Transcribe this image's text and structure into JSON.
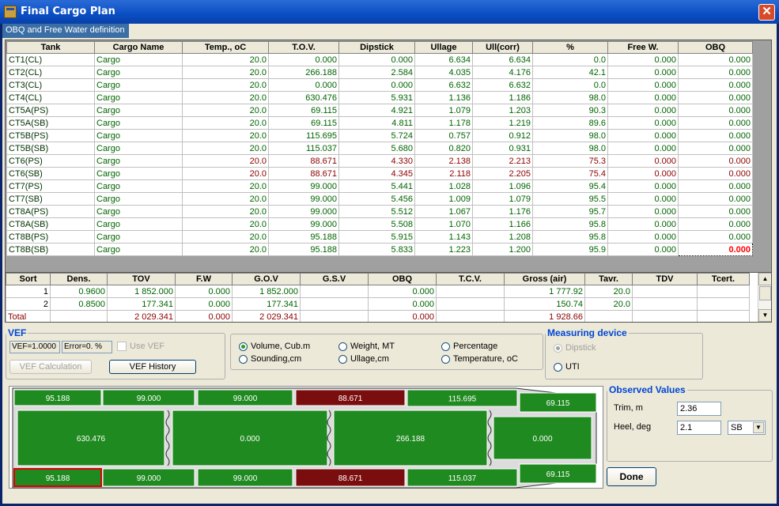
{
  "window": {
    "title": "Final Cargo Plan",
    "close_glyph": "✕"
  },
  "tab": {
    "label": "OBQ and Free Water definition"
  },
  "tank_table": {
    "headers": [
      "Tank",
      "Cargo Name",
      "Temp., oC",
      "T.O.V.",
      "Dipstick",
      "Ullage",
      "Ull(corr)",
      "%",
      "Free W.",
      "OBQ"
    ],
    "rows": [
      {
        "tank": "CT1(CL)",
        "cargo": "Cargo",
        "temp": "20.0",
        "tov": "0.000",
        "dipstick": "0.000",
        "ullage": "6.634",
        "ullcorr": "6.634",
        "pct": "0.0",
        "freew": "0.000",
        "obq": "0.000",
        "status": "green"
      },
      {
        "tank": "CT2(CL)",
        "cargo": "Cargo",
        "temp": "20.0",
        "tov": "266.188",
        "dipstick": "2.584",
        "ullage": "4.035",
        "ullcorr": "4.176",
        "pct": "42.1",
        "freew": "0.000",
        "obq": "0.000",
        "status": "green"
      },
      {
        "tank": "CT3(CL)",
        "cargo": "Cargo",
        "temp": "20.0",
        "tov": "0.000",
        "dipstick": "0.000",
        "ullage": "6.632",
        "ullcorr": "6.632",
        "pct": "0.0",
        "freew": "0.000",
        "obq": "0.000",
        "status": "green"
      },
      {
        "tank": "CT4(CL)",
        "cargo": "Cargo",
        "temp": "20.0",
        "tov": "630.476",
        "dipstick": "5.931",
        "ullage": "1.136",
        "ullcorr": "1.186",
        "pct": "98.0",
        "freew": "0.000",
        "obq": "0.000",
        "status": "green"
      },
      {
        "tank": "CT5A(PS)",
        "cargo": "Cargo",
        "temp": "20.0",
        "tov": "69.115",
        "dipstick": "4.921",
        "ullage": "1.079",
        "ullcorr": "1.203",
        "pct": "90.3",
        "freew": "0.000",
        "obq": "0.000",
        "status": "green"
      },
      {
        "tank": "CT5A(SB)",
        "cargo": "Cargo",
        "temp": "20.0",
        "tov": "69.115",
        "dipstick": "4.811",
        "ullage": "1.178",
        "ullcorr": "1.219",
        "pct": "89.6",
        "freew": "0.000",
        "obq": "0.000",
        "status": "green"
      },
      {
        "tank": "CT5B(PS)",
        "cargo": "Cargo",
        "temp": "20.0",
        "tov": "115.695",
        "dipstick": "5.724",
        "ullage": "0.757",
        "ullcorr": "0.912",
        "pct": "98.0",
        "freew": "0.000",
        "obq": "0.000",
        "status": "green"
      },
      {
        "tank": "CT5B(SB)",
        "cargo": "Cargo",
        "temp": "20.0",
        "tov": "115.037",
        "dipstick": "5.680",
        "ullage": "0.820",
        "ullcorr": "0.931",
        "pct": "98.0",
        "freew": "0.000",
        "obq": "0.000",
        "status": "green"
      },
      {
        "tank": "CT6(PS)",
        "cargo": "Cargo",
        "temp": "20.0",
        "tov": "88.671",
        "dipstick": "4.330",
        "ullage": "2.138",
        "ullcorr": "2.213",
        "pct": "75.3",
        "freew": "0.000",
        "obq": "0.000",
        "status": "red"
      },
      {
        "tank": "CT6(SB)",
        "cargo": "Cargo",
        "temp": "20.0",
        "tov": "88.671",
        "dipstick": "4.345",
        "ullage": "2.118",
        "ullcorr": "2.205",
        "pct": "75.4",
        "freew": "0.000",
        "obq": "0.000",
        "status": "red"
      },
      {
        "tank": "CT7(PS)",
        "cargo": "Cargo",
        "temp": "20.0",
        "tov": "99.000",
        "dipstick": "5.441",
        "ullage": "1.028",
        "ullcorr": "1.096",
        "pct": "95.4",
        "freew": "0.000",
        "obq": "0.000",
        "status": "green"
      },
      {
        "tank": "CT7(SB)",
        "cargo": "Cargo",
        "temp": "20.0",
        "tov": "99.000",
        "dipstick": "5.456",
        "ullage": "1.009",
        "ullcorr": "1.079",
        "pct": "95.5",
        "freew": "0.000",
        "obq": "0.000",
        "status": "green"
      },
      {
        "tank": "CT8A(PS)",
        "cargo": "Cargo",
        "temp": "20.0",
        "tov": "99.000",
        "dipstick": "5.512",
        "ullage": "1.067",
        "ullcorr": "1.176",
        "pct": "95.7",
        "freew": "0.000",
        "obq": "0.000",
        "status": "green"
      },
      {
        "tank": "CT8A(SB)",
        "cargo": "Cargo",
        "temp": "20.0",
        "tov": "99.000",
        "dipstick": "5.508",
        "ullage": "1.070",
        "ullcorr": "1.166",
        "pct": "95.8",
        "freew": "0.000",
        "obq": "0.000",
        "status": "green"
      },
      {
        "tank": "CT8B(PS)",
        "cargo": "Cargo",
        "temp": "20.0",
        "tov": "95.188",
        "dipstick": "5.915",
        "ullage": "1.143",
        "ullcorr": "1.208",
        "pct": "95.8",
        "freew": "0.000",
        "obq": "0.000",
        "status": "green"
      },
      {
        "tank": "CT8B(SB)",
        "cargo": "Cargo",
        "temp": "20.0",
        "tov": "95.188",
        "dipstick": "5.833",
        "ullage": "1.223",
        "ullcorr": "1.200",
        "pct": "95.9",
        "freew": "0.000",
        "obq": "0.000",
        "status": "green"
      }
    ]
  },
  "sort_table": {
    "headers": [
      "Sort",
      "Dens.",
      "TOV",
      "F.W",
      "G.O.V",
      "G.S.V",
      "OBQ",
      "T.C.V.",
      "Gross (air)",
      "Tavr.",
      "TDV",
      "Tcert."
    ],
    "rows": [
      {
        "sort": "1",
        "dens": "0.9600",
        "tov": "1 852.000",
        "fw": "0.000",
        "gov": "1 852.000",
        "gsv": "",
        "obq": "0.000",
        "tcv": "",
        "gross": "1 777.92",
        "tavr": "20.0",
        "tdv": "",
        "tcert": ""
      },
      {
        "sort": "2",
        "dens": "0.8500",
        "tov": "177.341",
        "fw": "0.000",
        "gov": "177.341",
        "gsv": "",
        "obq": "0.000",
        "tcv": "",
        "gross": "150.74",
        "tavr": "20.0",
        "tdv": "",
        "tcert": ""
      },
      {
        "sort": "Total",
        "dens": "",
        "tov": "2 029.341",
        "fw": "0.000",
        "gov": "2 029.341",
        "gsv": "",
        "obq": "0.000",
        "tcv": "",
        "gross": "1 928.66",
        "tavr": "",
        "tdv": "",
        "tcert": ""
      }
    ]
  },
  "vef": {
    "legend": "VEF",
    "vef_value": "VEF=1.0000",
    "error_value": "Error=0. %",
    "use_vef": "Use VEF",
    "calc_button": "VEF Calculation",
    "history_button": "VEF History"
  },
  "display_mode": {
    "options": [
      "Volume, Cub.m",
      "Weight, MT",
      "Percentage",
      "Sounding,cm",
      "Ullage,cm",
      "Temperature, oC"
    ],
    "selected": "Volume, Cub.m"
  },
  "measuring_device": {
    "legend": "Measuring device",
    "options": [
      "Dipstick",
      "UTI"
    ],
    "selected": "Dipstick"
  },
  "observed": {
    "legend": "Observed Values",
    "trim_label": "Trim, m",
    "trim_value": "2.36",
    "heel_label": "Heel, deg",
    "heel_value": "2.1",
    "heel_side": "SB"
  },
  "done_button": "Done",
  "ship_tanks": {
    "ps_row": [
      "95.188",
      "99.000",
      "99.000",
      "88.671",
      "115.695",
      "69.115"
    ],
    "center_row": [
      "630.476",
      "0.000",
      "266.188",
      "0.000"
    ],
    "sb_row": [
      "95.188",
      "99.000",
      "99.000",
      "88.671",
      "115.037",
      "69.115"
    ]
  },
  "colors": {
    "green": "#008000",
    "red": "#800000",
    "title": "#0a4ec4"
  }
}
